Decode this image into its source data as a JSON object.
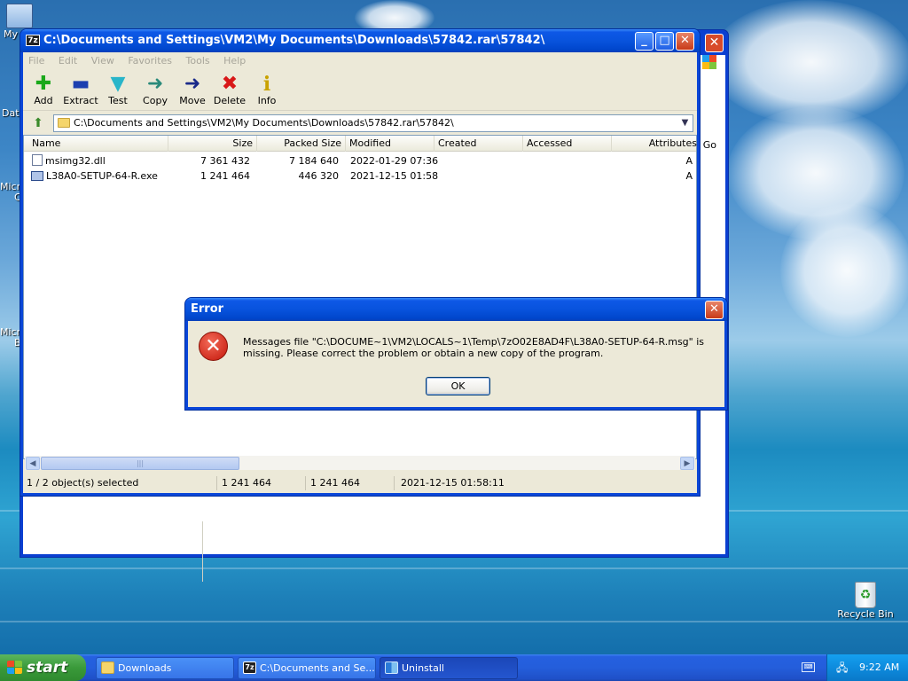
{
  "desktop": {
    "icons": [
      {
        "label": "My"
      },
      {
        "label": "Dat"
      },
      {
        "label": "Micro"
      },
      {
        "label": "C"
      },
      {
        "label": "Micro"
      },
      {
        "label": "B"
      }
    ],
    "recycle_bin": {
      "label": "Recycle Bin"
    },
    "back_window": {
      "go_label": "Go"
    }
  },
  "window": {
    "title": "C:\\Documents and Settings\\VM2\\My Documents\\Downloads\\57842.rar\\57842\\",
    "title_icon_text": "7z",
    "menu": [
      "File",
      "Edit",
      "View",
      "Favorites",
      "Tools",
      "Help"
    ],
    "toolbar": [
      {
        "label": "Add",
        "icon": "add-icon",
        "glyph": "✚",
        "color": "#1aa81a"
      },
      {
        "label": "Extract",
        "icon": "extract-icon",
        "glyph": "▬",
        "color": "#1c3fb0"
      },
      {
        "label": "Test",
        "icon": "test-icon",
        "glyph": "▼",
        "color": "#29b5c9"
      },
      {
        "label": "Copy",
        "icon": "copy-icon",
        "glyph": "➜",
        "color": "#2a8a7a"
      },
      {
        "label": "Move",
        "icon": "move-icon",
        "glyph": "➜",
        "color": "#1a2a8a"
      },
      {
        "label": "Delete",
        "icon": "delete-icon",
        "glyph": "✖",
        "color": "#d81818"
      },
      {
        "label": "Info",
        "icon": "info-icon",
        "glyph": "i",
        "color": "#c9a200"
      }
    ],
    "address": "C:\\Documents and Settings\\VM2\\My Documents\\Downloads\\57842.rar\\57842\\",
    "columns": {
      "name": "Name",
      "size": "Size",
      "packed": "Packed Size",
      "modified": "Modified",
      "created": "Created",
      "accessed": "Accessed",
      "attributes": "Attributes"
    },
    "files": [
      {
        "name": "msimg32.dll",
        "size": "7 361 432",
        "packed": "7 184 640",
        "modified": "2022-01-29 07:36",
        "created": "",
        "accessed": "",
        "attributes": "A",
        "type": "dll"
      },
      {
        "name": "L38A0-SETUP-64-R.exe",
        "size": "1 241 464",
        "packed": "446 320",
        "modified": "2021-12-15 01:58",
        "created": "",
        "accessed": "",
        "attributes": "A",
        "type": "exe"
      }
    ],
    "status": {
      "selection": "1 / 2 object(s) selected",
      "size": "1 241 464",
      "packed": "1 241 464",
      "modified": "2021-12-15 01:58:11"
    }
  },
  "dialog": {
    "title": "Error",
    "message": "Messages file \"C:\\DOCUME~1\\VM2\\LOCALS~1\\Temp\\7zO02E8AD4F\\L38A0-SETUP-64-R.msg\" is missing. Please correct the problem or obtain a new copy of the program.",
    "ok_label": "OK"
  },
  "taskbar": {
    "start_label": "start",
    "tasks": [
      {
        "label": "Downloads",
        "icon": "folder-icon"
      },
      {
        "label": "C:\\Documents and Se...",
        "icon": "7zip-icon"
      },
      {
        "label": "Uninstall",
        "icon": "uninstall-icon"
      }
    ],
    "clock": "9:22 AM"
  }
}
